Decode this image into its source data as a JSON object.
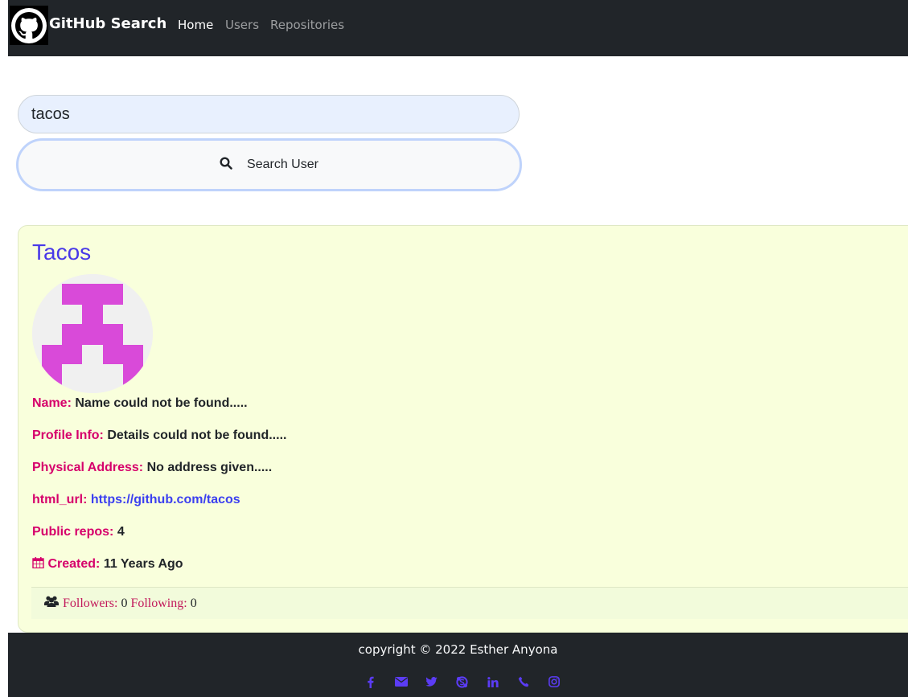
{
  "navbar": {
    "brand": "GitHub Search",
    "links": [
      {
        "label": "Home",
        "active": true
      },
      {
        "label": "Users",
        "active": false
      },
      {
        "label": "Repositories",
        "active": false
      }
    ]
  },
  "search": {
    "value": "tacos",
    "placeholder": "",
    "button_label": "Search User"
  },
  "user": {
    "title": "Tacos",
    "name_label": "Name:",
    "name_value": "Name could not be found.....",
    "profile_label": "Profile Info:",
    "profile_value": "Details could not be found.....",
    "address_label": "Physical Address:",
    "address_value": "No address given.....",
    "url_label": "html_url:",
    "url_value": "https://github.com/tacos",
    "repos_label": "Public repos:",
    "repos_value": "4",
    "created_label": "Created:",
    "created_value": "11 Years Ago",
    "followers_label": "Followers:",
    "followers_value": "0",
    "following_label": "Following:",
    "following_value": "0"
  },
  "footer": {
    "copyright": "copyright © 2022 Esther Anyona",
    "social_icons": [
      "facebook-icon",
      "envelope-icon",
      "twitter-icon",
      "skype-icon",
      "linkedin-icon",
      "phone-icon",
      "instagram-icon"
    ]
  },
  "colors": {
    "navbar_bg": "#212529",
    "card_bg": "#f9ffdc",
    "label": "#d6006b",
    "link": "#3b3ff0",
    "avatar_fill": "#d94ad9",
    "social_icon": "#5b3cf5"
  }
}
